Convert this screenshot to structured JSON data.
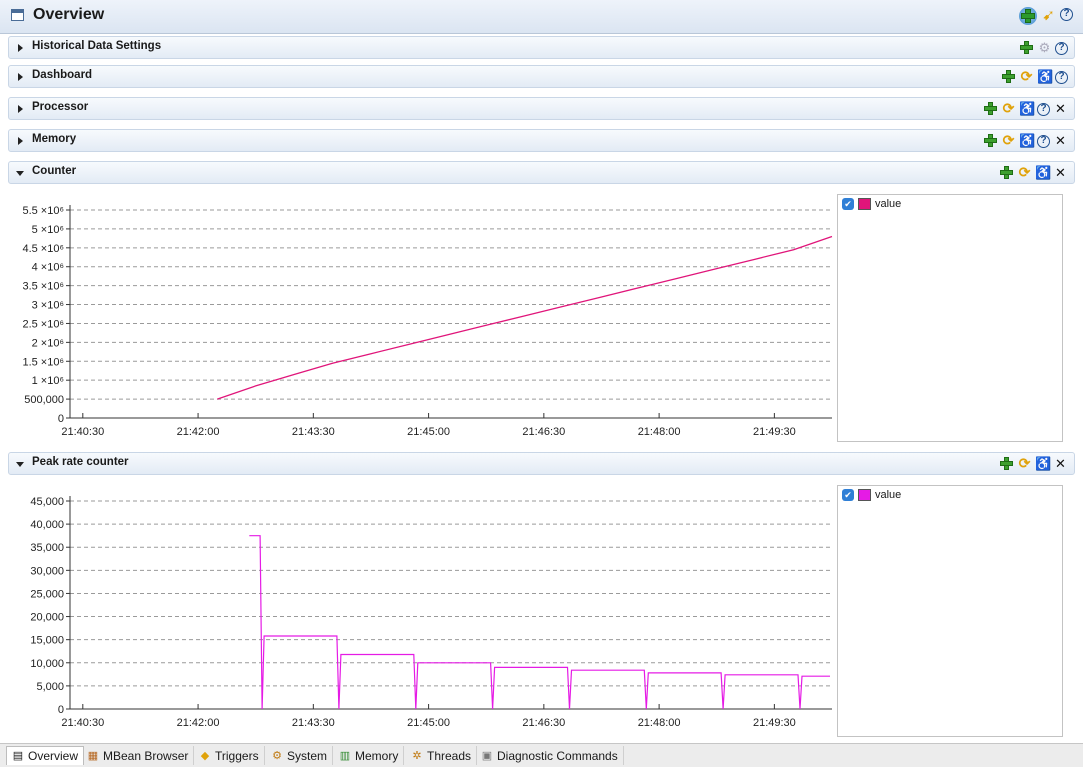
{
  "header": {
    "title": "Overview"
  },
  "sections": [
    {
      "label": "Historical Data Settings",
      "expanded": false
    },
    {
      "label": "Dashboard",
      "expanded": false
    },
    {
      "label": "Processor",
      "expanded": false
    },
    {
      "label": "Memory",
      "expanded": false
    },
    {
      "label": "Counter",
      "expanded": true
    },
    {
      "label": "Peak rate counter",
      "expanded": true
    }
  ],
  "legend": {
    "counter_label": "value",
    "peak_label": "value"
  },
  "colors": {
    "counter_line": "#e0157a",
    "peak_line": "#e51be5"
  },
  "tabs": [
    {
      "label": "Overview",
      "icon": "overview-icon"
    },
    {
      "label": "MBean Browser",
      "icon": "mbean-browser-icon"
    },
    {
      "label": "Triggers",
      "icon": "triggers-icon"
    },
    {
      "label": "System",
      "icon": "system-icon"
    },
    {
      "label": "Memory",
      "icon": "memory-icon"
    },
    {
      "label": "Threads",
      "icon": "threads-icon"
    },
    {
      "label": "Diagnostic Commands",
      "icon": "diagnostic-commands-icon"
    }
  ],
  "chart_data": [
    {
      "type": "line",
      "series": [
        {
          "name": "value",
          "x": [
            "21:42:15",
            "21:42:45",
            "21:43:15",
            "21:43:45",
            "21:44:15",
            "21:44:45",
            "21:45:15",
            "21:45:45",
            "21:46:15",
            "21:46:45",
            "21:47:15",
            "21:47:45",
            "21:48:15",
            "21:48:45",
            "21:49:15",
            "21:49:45",
            "21:50:15"
          ],
          "values": [
            500000,
            850000,
            1150000,
            1450000,
            1700000,
            1950000,
            2200000,
            2450000,
            2700000,
            2950000,
            3200000,
            3450000,
            3700000,
            3950000,
            4200000,
            4450000,
            4800000
          ]
        }
      ],
      "x_ticks": [
        "21:40:30",
        "21:42:00",
        "21:43:30",
        "21:45:00",
        "21:46:30",
        "21:48:00",
        "21:49:30"
      ],
      "y_ticks": [
        "0",
        "500,000",
        "1 ×10⁶",
        "1.5 ×10⁶",
        "2 ×10⁶",
        "2.5 ×10⁶",
        "3 ×10⁶",
        "3.5 ×10⁶",
        "4 ×10⁶",
        "4.5 ×10⁶",
        "5 ×10⁶",
        "5.5 ×10⁶"
      ],
      "ylim": [
        0,
        5500000
      ],
      "grid": true
    },
    {
      "type": "line",
      "series": [
        {
          "name": "value",
          "steps": [
            {
              "from": "21:42:40",
              "to": "21:42:50",
              "value": 37500
            },
            {
              "from": "21:42:50",
              "to": "21:43:50",
              "value": 15800
            },
            {
              "from": "21:43:50",
              "to": "21:44:50",
              "value": 11800
            },
            {
              "from": "21:44:50",
              "to": "21:45:50",
              "value": 10000
            },
            {
              "from": "21:45:50",
              "to": "21:46:50",
              "value": 9000
            },
            {
              "from": "21:46:50",
              "to": "21:47:50",
              "value": 8400
            },
            {
              "from": "21:47:50",
              "to": "21:48:50",
              "value": 7800
            },
            {
              "from": "21:48:50",
              "to": "21:49:50",
              "value": 7400
            },
            {
              "from": "21:49:50",
              "to": "21:50:15",
              "value": 7100
            }
          ]
        }
      ],
      "x_ticks": [
        "21:40:30",
        "21:42:00",
        "21:43:30",
        "21:45:00",
        "21:46:30",
        "21:48:00",
        "21:49:30"
      ],
      "y_ticks": [
        "0",
        "5,000",
        "10,000",
        "15,000",
        "20,000",
        "25,000",
        "30,000",
        "35,000",
        "40,000",
        "45,000"
      ],
      "ylim": [
        0,
        45000
      ],
      "grid": true
    }
  ]
}
